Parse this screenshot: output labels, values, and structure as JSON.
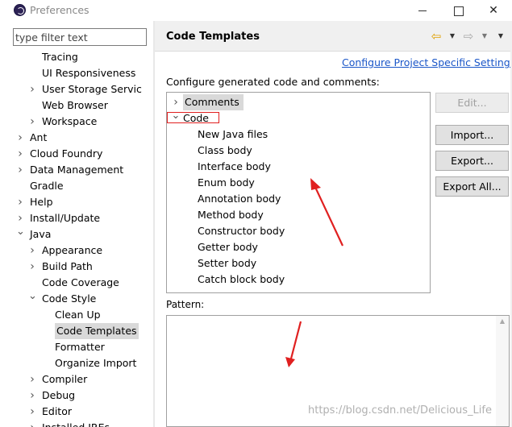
{
  "window": {
    "title": "Preferences",
    "minimize": "",
    "maximize": "",
    "close": "✕"
  },
  "filter": {
    "placeholder": "type filter text"
  },
  "tree": [
    {
      "label": "Tracing",
      "indent": 2,
      "expander": ""
    },
    {
      "label": "UI Responsiveness",
      "indent": 2,
      "expander": ""
    },
    {
      "label": "User Storage Servic",
      "indent": 2,
      "expander": "collapsed"
    },
    {
      "label": "Web Browser",
      "indent": 2,
      "expander": ""
    },
    {
      "label": "Workspace",
      "indent": 2,
      "expander": "collapsed"
    },
    {
      "label": "Ant",
      "indent": 1,
      "expander": "collapsed"
    },
    {
      "label": "Cloud Foundry",
      "indent": 1,
      "expander": "collapsed"
    },
    {
      "label": "Data Management",
      "indent": 1,
      "expander": "collapsed"
    },
    {
      "label": "Gradle",
      "indent": 1,
      "expander": ""
    },
    {
      "label": "Help",
      "indent": 1,
      "expander": "collapsed"
    },
    {
      "label": "Install/Update",
      "indent": 1,
      "expander": "collapsed"
    },
    {
      "label": "Java",
      "indent": 1,
      "expander": "expanded"
    },
    {
      "label": "Appearance",
      "indent": 2,
      "expander": "collapsed"
    },
    {
      "label": "Build Path",
      "indent": 2,
      "expander": "collapsed"
    },
    {
      "label": "Code Coverage",
      "indent": 2,
      "expander": ""
    },
    {
      "label": "Code Style",
      "indent": 2,
      "expander": "expanded"
    },
    {
      "label": "Clean Up",
      "indent": 3,
      "expander": ""
    },
    {
      "label": "Code Templates",
      "indent": 3,
      "expander": "",
      "selected": true
    },
    {
      "label": "Formatter",
      "indent": 3,
      "expander": ""
    },
    {
      "label": "Organize Import",
      "indent": 3,
      "expander": ""
    },
    {
      "label": "Compiler",
      "indent": 2,
      "expander": "collapsed"
    },
    {
      "label": "Debug",
      "indent": 2,
      "expander": "collapsed"
    },
    {
      "label": "Editor",
      "indent": 2,
      "expander": "collapsed"
    },
    {
      "label": "Installed JREs",
      "indent": 2,
      "expander": "collapsed"
    }
  ],
  "header": {
    "title": "Code Templates",
    "back_icon": "⇦",
    "dropdown_icon": "▼",
    "forward_icon": "⇨",
    "menu_icon": "▼"
  },
  "configure_link": "Configure Project Specific Settings...",
  "configure_label": "Configure generated code and comments:",
  "templates": [
    {
      "label": "Comments",
      "level": 0,
      "expander": "collapsed",
      "selected": true
    },
    {
      "label": "Code",
      "level": 0,
      "expander": "expanded",
      "highlighted": true
    },
    {
      "label": "New Java files",
      "level": 1
    },
    {
      "label": "Class body",
      "level": 1
    },
    {
      "label": "Interface body",
      "level": 1
    },
    {
      "label": "Enum body",
      "level": 1
    },
    {
      "label": "Annotation body",
      "level": 1
    },
    {
      "label": "Method body",
      "level": 1
    },
    {
      "label": "Constructor body",
      "level": 1
    },
    {
      "label": "Getter body",
      "level": 1
    },
    {
      "label": "Setter body",
      "level": 1
    },
    {
      "label": "Catch block body",
      "level": 1
    }
  ],
  "buttons": {
    "edit": "Edit...",
    "import": "Import...",
    "export": "Export...",
    "export_all": "Export All..."
  },
  "pattern": {
    "label": "Pattern:",
    "value": ""
  },
  "watermark": "https://blog.csdn.net/Delicious_Life",
  "colors": {
    "link": "#1a56c8",
    "highlight_box": "#e02020",
    "annotation_arrow": "#e02020",
    "selection": "#d9d9d9"
  },
  "icons": {
    "app": "eclipse-icon",
    "collapsed": "chevron-right-icon",
    "expanded": "chevron-down-icon"
  }
}
